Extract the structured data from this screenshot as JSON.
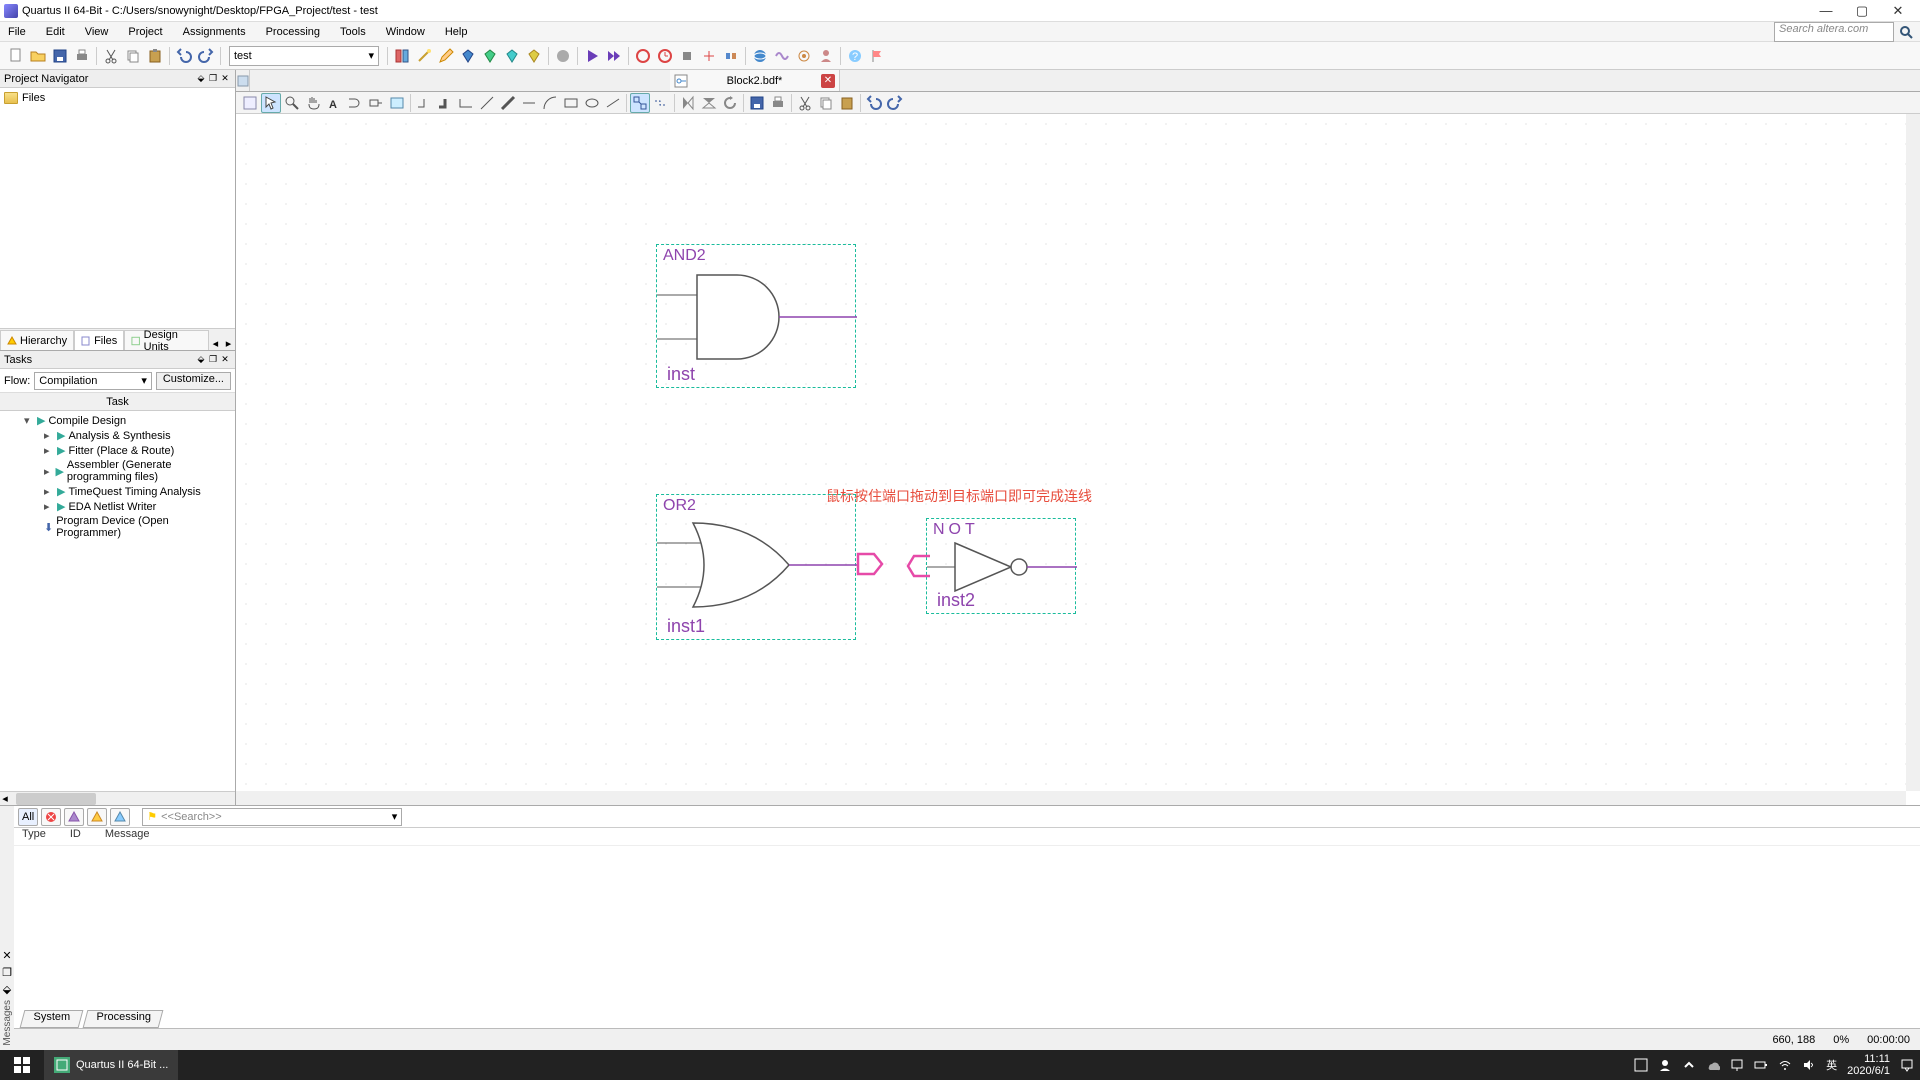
{
  "window": {
    "title": "Quartus II 64-Bit - C:/Users/snowynight/Desktop/FPGA_Project/test - test"
  },
  "menu": [
    "File",
    "Edit",
    "View",
    "Project",
    "Assignments",
    "Processing",
    "Tools",
    "Window",
    "Help"
  ],
  "search": {
    "placeholder": "Search altera.com"
  },
  "main_toolbar": {
    "project_combo": "test"
  },
  "project_navigator": {
    "title": "Project Navigator",
    "root": "Files",
    "tabs": {
      "hierarchy": "Hierarchy",
      "files": "Files",
      "design_units": "Design Units"
    }
  },
  "tasks": {
    "title": "Tasks",
    "flow_label": "Flow:",
    "flow_value": "Compilation",
    "customize": "Customize...",
    "header": "Task",
    "items": [
      "Compile Design",
      "Analysis & Synthesis",
      "Fitter (Place & Route)",
      "Assembler (Generate programming files)",
      "TimeQuest Timing Analysis",
      "EDA Netlist Writer",
      "Program Device (Open Programmer)"
    ]
  },
  "document": {
    "tab": "Block2.bdf*"
  },
  "schematic": {
    "and": {
      "label": "AND2",
      "inst": "inst"
    },
    "or": {
      "label": "OR2",
      "inst": "inst1"
    },
    "not": {
      "label": "NOT",
      "inst": "inst2"
    },
    "hint": "鼠标按住端口拖动到目标端口即可完成连线"
  },
  "messages": {
    "vlabel": "Messages",
    "filters": {
      "all": "All"
    },
    "search_placeholder": "<<Search>>",
    "columns": [
      "Type",
      "ID",
      "Message"
    ],
    "tabs": [
      "System",
      "Processing"
    ]
  },
  "status": {
    "coords": "660, 188",
    "zoom": "0%",
    "time_elapsed": "00:00:00"
  },
  "taskbar": {
    "app": "Quartus II 64-Bit ...",
    "ime_lang": "英",
    "clock_time": "11:11",
    "clock_date": "2020/6/1"
  }
}
